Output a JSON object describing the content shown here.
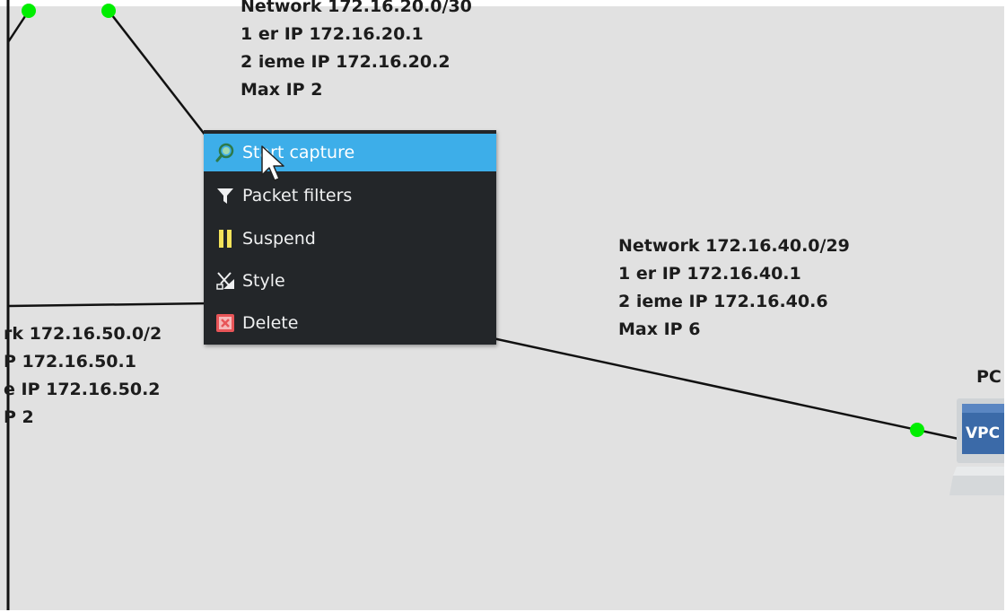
{
  "networks": [
    {
      "id": "net-20",
      "lines": [
        "Network 172.16.20.0/30",
        "1 er IP 172.16.20.1",
        "2 ieme IP 172.16.20.2",
        "Max IP 2"
      ]
    },
    {
      "id": "net-40",
      "lines": [
        "Network 172.16.40.0/29",
        "1 er IP 172.16.40.1",
        "2 ieme IP 172.16.40.6",
        "Max IP 6"
      ]
    },
    {
      "id": "net-50",
      "lines": [
        "rk 172.16.50.0/2",
        "P 172.16.50.1",
        "e IP 172.16.50.2",
        "P 2"
      ]
    }
  ],
  "device": {
    "label": "PC",
    "screen_text": "VPC"
  },
  "context_menu": {
    "items": [
      {
        "label": "Start capture",
        "icon": "capture-icon",
        "highlighted": true
      },
      {
        "label": "Packet filters",
        "icon": "filter-icon",
        "highlighted": false
      },
      {
        "label": "Suspend",
        "icon": "pause-icon",
        "highlighted": false
      },
      {
        "label": "Style",
        "icon": "style-icon",
        "highlighted": false
      },
      {
        "label": "Delete",
        "icon": "delete-icon",
        "highlighted": false
      }
    ]
  },
  "colors": {
    "canvas": "#e1e1e1",
    "menu_bg": "#232629",
    "menu_highlight": "#3daee9",
    "link_endpoint": "#00ee00",
    "link": "#111111",
    "delete_red": "#e85558",
    "suspend_yellow": "#f3e35a"
  }
}
